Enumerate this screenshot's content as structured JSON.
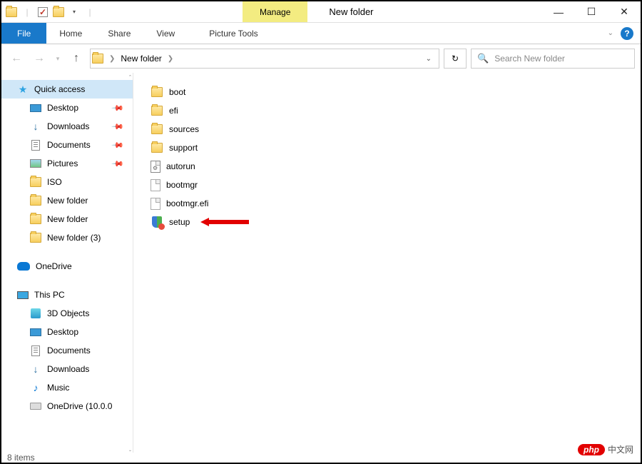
{
  "title": "New folder",
  "context_tab": "Manage",
  "context_sub": "Picture Tools",
  "ribbon": {
    "file": "File",
    "tabs": [
      "Home",
      "Share",
      "View"
    ]
  },
  "nav": {
    "breadcrumb": [
      "New folder"
    ],
    "search_placeholder": "Search New folder"
  },
  "sidebar": {
    "quick_access": "Quick access",
    "qa_items": [
      {
        "label": "Desktop",
        "icon": "desktop",
        "pinned": true
      },
      {
        "label": "Downloads",
        "icon": "download",
        "pinned": true
      },
      {
        "label": "Documents",
        "icon": "doc",
        "pinned": true
      },
      {
        "label": "Pictures",
        "icon": "pic",
        "pinned": true
      },
      {
        "label": "ISO",
        "icon": "folder",
        "pinned": false
      },
      {
        "label": "New folder",
        "icon": "folder",
        "pinned": false
      },
      {
        "label": "New folder",
        "icon": "folder",
        "pinned": false
      },
      {
        "label": "New folder (3)",
        "icon": "folder",
        "pinned": false
      }
    ],
    "onedrive": "OneDrive",
    "thispc": "This PC",
    "pc_items": [
      {
        "label": "3D Objects",
        "icon": "obj"
      },
      {
        "label": "Desktop",
        "icon": "desktop"
      },
      {
        "label": "Documents",
        "icon": "doc"
      },
      {
        "label": "Downloads",
        "icon": "download"
      },
      {
        "label": "Music",
        "icon": "music"
      },
      {
        "label": "OneDrive (10.0.0",
        "icon": "drive"
      }
    ]
  },
  "files": [
    {
      "name": "boot",
      "type": "folder"
    },
    {
      "name": "efi",
      "type": "folder"
    },
    {
      "name": "sources",
      "type": "folder"
    },
    {
      "name": "support",
      "type": "folder"
    },
    {
      "name": "autorun",
      "type": "inf"
    },
    {
      "name": "bootmgr",
      "type": "file"
    },
    {
      "name": "bootmgr.efi",
      "type": "file"
    },
    {
      "name": "setup",
      "type": "exe"
    }
  ],
  "status": "8 items",
  "watermark": {
    "brand": "php",
    "text": "中文网"
  }
}
